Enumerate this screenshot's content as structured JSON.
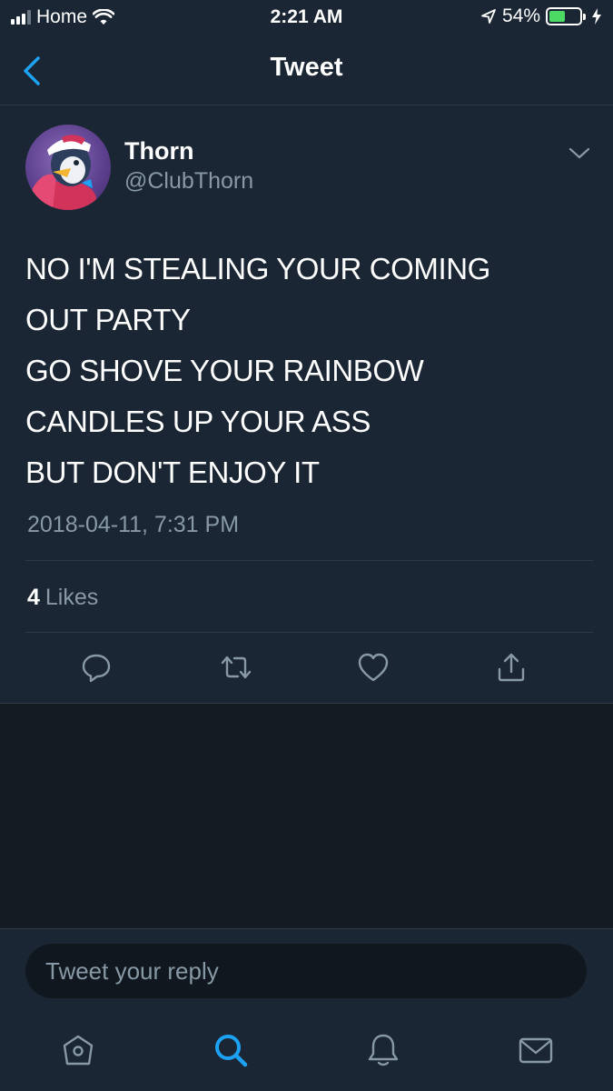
{
  "status_bar": {
    "carrier": "Home",
    "time": "2:21 AM",
    "battery_percent": "54%",
    "battery_level": 0.54,
    "icons": [
      "signal-icon",
      "wifi-icon",
      "location-icon",
      "battery-icon",
      "charging-icon"
    ]
  },
  "nav": {
    "title": "Tweet",
    "back_icon": "chevron-left-icon"
  },
  "tweet": {
    "author_name": "Thorn",
    "author_handle": "@ClubThorn",
    "text_lines": [
      "NO I'M STEALING YOUR COMING",
      "OUT PARTY",
      "GO SHOVE YOUR RAINBOW",
      "CANDLES UP YOUR ASS",
      "BUT DON'T ENJOY IT"
    ],
    "timestamp": "2018-04-11, 7:31 PM",
    "likes_count": "4",
    "likes_label": "Likes",
    "actions": [
      "reply-icon",
      "retweet-icon",
      "like-icon",
      "share-icon"
    ]
  },
  "reply": {
    "placeholder": "Tweet your reply"
  },
  "tabbar": {
    "items": [
      "home-icon",
      "search-icon",
      "notifications-icon",
      "messages-icon"
    ],
    "active": "search-icon"
  },
  "colors": {
    "background": "#141b23",
    "card": "#1b2634",
    "secondary_text": "#8899a6",
    "accent": "#1da1f2",
    "battery": "#4cd964"
  }
}
